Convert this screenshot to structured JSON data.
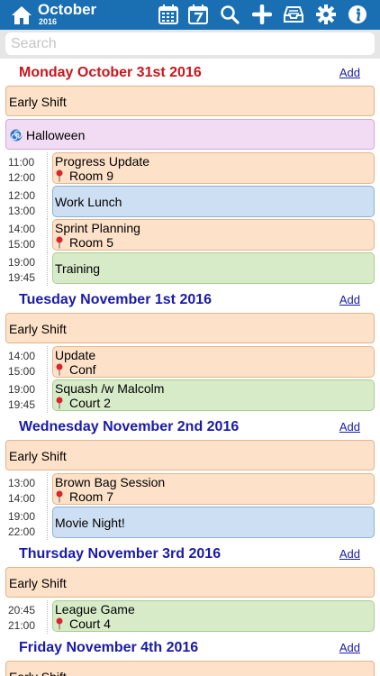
{
  "header": {
    "month": "October",
    "year": "2016"
  },
  "search": {
    "placeholder": "Search"
  },
  "days": [
    {
      "title": "Monday October 31st 2016",
      "color": "#c8161d",
      "add": "Add",
      "allday": [
        {
          "label": "Early Shift",
          "style": "orange"
        },
        {
          "label": "Halloween",
          "style": "purple",
          "icon": "spiral-icon"
        }
      ],
      "events": [
        {
          "start": "11:00",
          "end": "12:00",
          "title": "Progress Update",
          "location": "Room 9",
          "style": "orange"
        },
        {
          "start": "12:00",
          "end": "13:00",
          "title": "Work Lunch",
          "location": "",
          "style": "blue"
        },
        {
          "start": "14:00",
          "end": "15:00",
          "title": "Sprint Planning",
          "location": "Room 5",
          "style": "orange"
        },
        {
          "start": "19:00",
          "end": "19:45",
          "title": "Training",
          "location": "",
          "style": "green"
        }
      ]
    },
    {
      "title": "Tuesday November 1st 2016",
      "color": "#1a1aa8",
      "add": "Add",
      "allday": [
        {
          "label": "Early Shift",
          "style": "orange"
        }
      ],
      "events": [
        {
          "start": "14:00",
          "end": "15:00",
          "title": "Update",
          "location": "Conf",
          "style": "orange"
        },
        {
          "start": "19:00",
          "end": "19:45",
          "title": "Squash /w Malcolm",
          "location": "Court 2",
          "style": "green"
        }
      ]
    },
    {
      "title": "Wednesday November 2nd 2016",
      "color": "#1a1aa8",
      "add": "Add",
      "allday": [
        {
          "label": "Early Shift",
          "style": "orange"
        }
      ],
      "events": [
        {
          "start": "13:00",
          "end": "14:00",
          "title": "Brown Bag Session",
          "location": "Room 7",
          "style": "orange"
        },
        {
          "start": "19:00",
          "end": "22:00",
          "title": "Movie Night!",
          "location": "",
          "style": "blue"
        }
      ]
    },
    {
      "title": "Thursday November 3rd 2016",
      "color": "#1a1aa8",
      "add": "Add",
      "allday": [
        {
          "label": "Early Shift",
          "style": "orange"
        }
      ],
      "events": [
        {
          "start": "20:45",
          "end": "21:00",
          "title": "League Game",
          "location": "Court 4",
          "style": "green"
        }
      ]
    },
    {
      "title": "Friday November 4th 2016",
      "color": "#1a1aa8",
      "add": "Add",
      "allday": [
        {
          "label": "Early Shift",
          "style": "orange"
        }
      ],
      "events": []
    }
  ]
}
